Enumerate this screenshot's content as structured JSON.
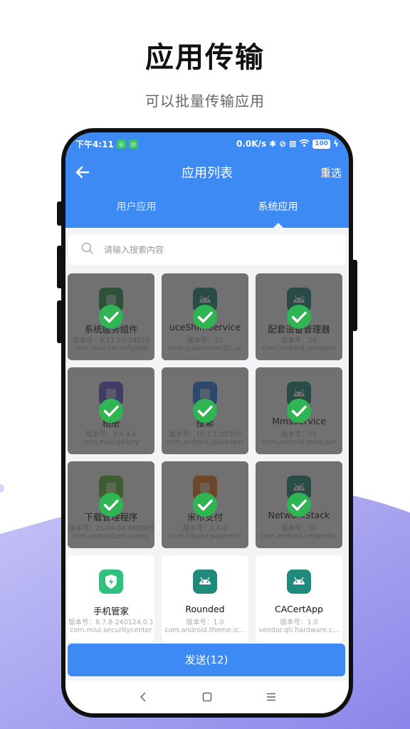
{
  "promo": {
    "title": "应用传输",
    "subtitle": "可以批量传输应用"
  },
  "status_bar": {
    "time": "下午4:11",
    "speed": "0.0K/s",
    "battery": "100",
    "icons": [
      "notification-badge",
      "notification-badge",
      "bluetooth-icon",
      "alarm-off-icon",
      "screen-record-icon",
      "wifi-icon",
      "battery-icon",
      "charging-icon"
    ]
  },
  "toolbar": {
    "title": "应用列表",
    "reselect_label": "重选",
    "back_icon": "arrow-left-icon"
  },
  "tabs": [
    {
      "label": "用户应用",
      "active": false
    },
    {
      "label": "系统应用",
      "active": true
    }
  ],
  "search": {
    "placeholder": "请输入搜索内容",
    "value": ""
  },
  "apps": [
    {
      "name": "系统服务组件",
      "version": "版本号：9.11.57-24010",
      "package": "com.miui.securityadd",
      "selected": true,
      "icon": "layers-icon",
      "color": "#2f9b52"
    },
    {
      "name": "uceShimService",
      "version": "版本号：10",
      "package": "com.qualcomm.qti.uc",
      "selected": true,
      "icon": "android-icon",
      "color": "#1f8b7c"
    },
    {
      "name": "配套设备管理器",
      "version": "版本号：10",
      "package": "com.android.compani",
      "selected": true,
      "icon": "android-icon",
      "color": "#1f8b7c"
    },
    {
      "name": "相册",
      "version": "版本号：3.4.9.6",
      "package": "com.miui.gallery",
      "selected": true,
      "icon": "gallery-icon",
      "color": "#6a5ae0"
    },
    {
      "name": "搜索",
      "version": "版本号：10.7.1.05310",
      "package": "com.android.quicksear",
      "selected": true,
      "icon": "search-app-icon",
      "color": "#2f7df0"
    },
    {
      "name": "MmsService",
      "version": "版本号：10",
      "package": "com.android.mms.ser",
      "selected": true,
      "icon": "android-icon",
      "color": "#1f8b7c"
    },
    {
      "name": "下载管理程序",
      "version": "版本号：21.04.08.800003",
      "package": "com.android.providers.",
      "selected": true,
      "icon": "download-icon",
      "color": "#5fc03a"
    },
    {
      "name": "米币支付",
      "version": "版本号：2.6.0",
      "package": "com.xiaomi.payment",
      "selected": true,
      "icon": "mi-coin-icon",
      "color": "#f07a1e"
    },
    {
      "name": "NetworkStack",
      "version": "版本号：10",
      "package": "com.android.networks.",
      "selected": true,
      "icon": "android-icon",
      "color": "#1f8b7c"
    },
    {
      "name": "手机管家",
      "version": "版本号：8.7.8-240124.0.1",
      "package": "com.miui.securitycenter",
      "selected": false,
      "icon": "shield-bolt-icon",
      "color": "#2ec27e"
    },
    {
      "name": "Rounded",
      "version": "版本号：1.0",
      "package": "com.android.theme.ic...",
      "selected": false,
      "icon": "android-icon",
      "color": "#1f8b7c"
    },
    {
      "name": "CACertApp",
      "version": "版本号：1.0",
      "package": "vendor.qti.hardware.c...",
      "selected": false,
      "icon": "android-icon",
      "color": "#1f8b7c"
    }
  ],
  "send_button": {
    "label": "发送(12)"
  },
  "nav_bar": {
    "back": "chevron-left-icon",
    "home": "square-home-icon",
    "menu": "menu-lines-icon"
  },
  "colors": {
    "primary": "#3d8af4",
    "check": "#2fb552"
  }
}
